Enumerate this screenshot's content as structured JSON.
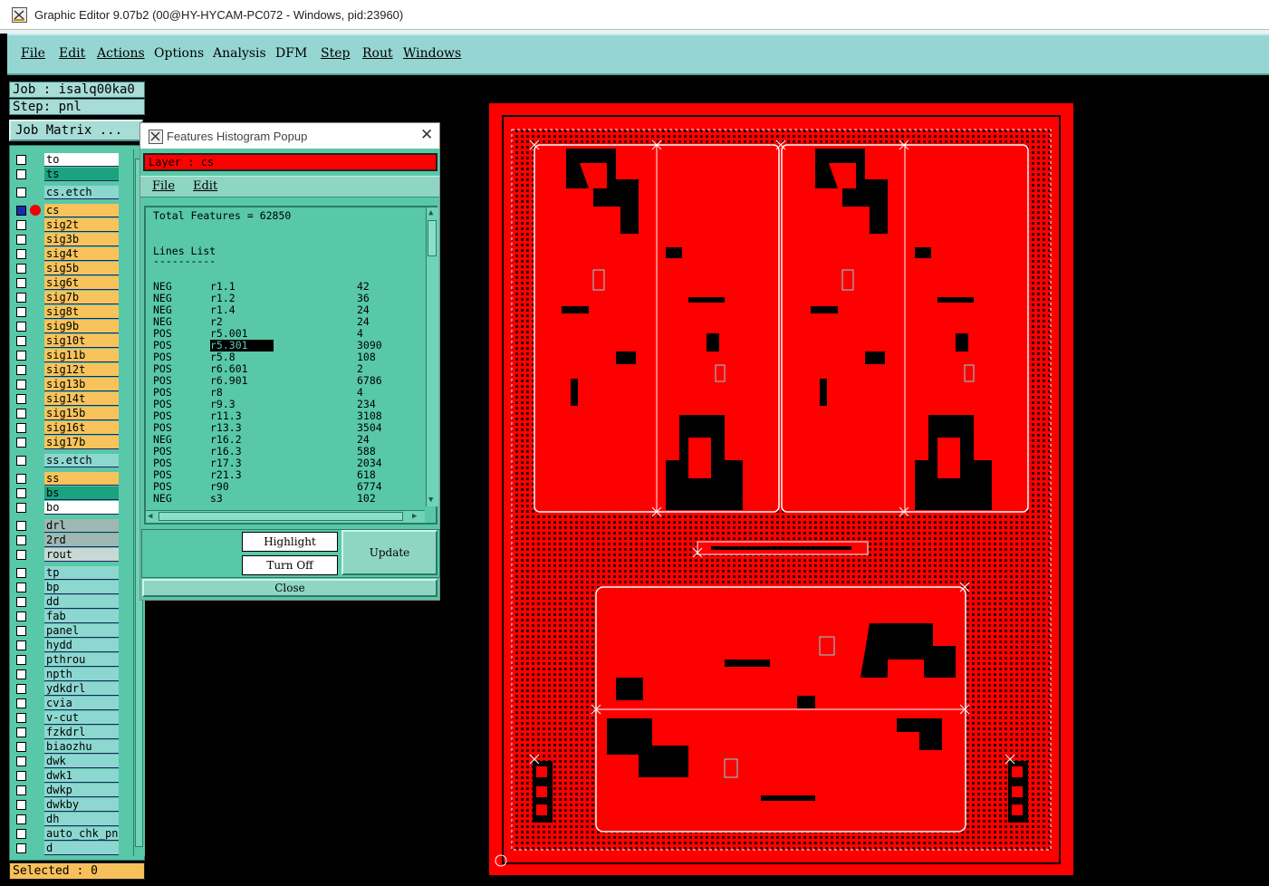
{
  "window": {
    "title": "Graphic Editor 9.07b2 (00@HY-HYCAM-PC072 - Windows, pid:23960)"
  },
  "menu": [
    {
      "label": "File",
      "u": true
    },
    {
      "label": "Edit",
      "u": true
    },
    {
      "label": "Actions",
      "u": true
    },
    {
      "label": "Options",
      "u": false
    },
    {
      "label": "Analysis",
      "u": false
    },
    {
      "label": "DFM",
      "u": false
    },
    {
      "label": "Step",
      "u": true
    },
    {
      "label": "Rout",
      "u": true
    },
    {
      "label": "Windows",
      "u": true
    }
  ],
  "job": {
    "job_text": "Job : isalq00ka0",
    "step_text": "Step: pnl",
    "matrix_button": "Job Matrix ..."
  },
  "layers": [
    {
      "name": "to",
      "color": "#ffffff"
    },
    {
      "name": "ts",
      "color": "#1aa37f"
    },
    {
      "name": "cs.etch",
      "color": "#8cd8d0"
    },
    {
      "name": "cs",
      "color": "#f7c35a",
      "active": true
    },
    {
      "name": "sig2t",
      "color": "#f7c35a"
    },
    {
      "name": "sig3b",
      "color": "#f7c35a"
    },
    {
      "name": "sig4t",
      "color": "#f7c35a"
    },
    {
      "name": "sig5b",
      "color": "#f7c35a"
    },
    {
      "name": "sig6t",
      "color": "#f7c35a"
    },
    {
      "name": "sig7b",
      "color": "#f7c35a"
    },
    {
      "name": "sig8t",
      "color": "#f7c35a"
    },
    {
      "name": "sig9b",
      "color": "#f7c35a"
    },
    {
      "name": "sig10t",
      "color": "#f7c35a"
    },
    {
      "name": "sig11b",
      "color": "#f7c35a"
    },
    {
      "name": "sig12t",
      "color": "#f7c35a"
    },
    {
      "name": "sig13b",
      "color": "#f7c35a"
    },
    {
      "name": "sig14t",
      "color": "#f7c35a"
    },
    {
      "name": "sig15b",
      "color": "#f7c35a"
    },
    {
      "name": "sig16t",
      "color": "#f7c35a"
    },
    {
      "name": "sig17b",
      "color": "#f7c35a"
    },
    {
      "name": "ss.etch",
      "color": "#8cd8d0"
    },
    {
      "name": "ss",
      "color": "#f7c35a"
    },
    {
      "name": "bs",
      "color": "#1aa37f"
    },
    {
      "name": "bo",
      "color": "#ffffff"
    },
    {
      "name": "drl",
      "color": "#9fb8b4"
    },
    {
      "name": "2rd",
      "color": "#9fb8b4"
    },
    {
      "name": "rout",
      "color": "#c8d8d4"
    },
    {
      "name": "tp",
      "color": "#8cd8d0"
    },
    {
      "name": "bp",
      "color": "#8cd8d0"
    },
    {
      "name": "dd",
      "color": "#8cd8d0"
    },
    {
      "name": "fab",
      "color": "#8cd8d0"
    },
    {
      "name": "panel",
      "color": "#8cd8d0"
    },
    {
      "name": "hydd",
      "color": "#8cd8d0"
    },
    {
      "name": "pthrou",
      "color": "#8cd8d0"
    },
    {
      "name": "npth",
      "color": "#8cd8d0"
    },
    {
      "name": "ydkdrl",
      "color": "#8cd8d0"
    },
    {
      "name": "cvia",
      "color": "#8cd8d0"
    },
    {
      "name": "v-cut",
      "color": "#8cd8d0"
    },
    {
      "name": "fzkdrl",
      "color": "#8cd8d0"
    },
    {
      "name": "biaozhu",
      "color": "#8cd8d0"
    },
    {
      "name": "dwk",
      "color": "#8cd8d0"
    },
    {
      "name": "dwk1",
      "color": "#8cd8d0"
    },
    {
      "name": "dwkp",
      "color": "#8cd8d0"
    },
    {
      "name": "dwkby",
      "color": "#8cd8d0"
    },
    {
      "name": "dh",
      "color": "#8cd8d0"
    },
    {
      "name": "auto_chk_pnl",
      "color": "#8cd8d0"
    },
    {
      "name": "d",
      "color": "#8cd8d0"
    }
  ],
  "status": {
    "selected": "Selected : 0"
  },
  "popup": {
    "title": "Features Histogram Popup",
    "layer_text": "Layer :  cs",
    "menu": [
      "File",
      "Edit"
    ],
    "total_text": "Total Features = 62850",
    "list_title": "Lines List",
    "list_rule": "----------",
    "rows": [
      {
        "pol": "NEG",
        "sym": "r1.1",
        "count": "42"
      },
      {
        "pol": "NEG",
        "sym": "r1.2",
        "count": "36"
      },
      {
        "pol": "NEG",
        "sym": "r1.4",
        "count": "24"
      },
      {
        "pol": "NEG",
        "sym": "r2",
        "count": "24"
      },
      {
        "pol": "POS",
        "sym": "r5.001",
        "count": "4"
      },
      {
        "pol": "POS",
        "sym": "r5.301",
        "count": "3090",
        "selected": true
      },
      {
        "pol": "POS",
        "sym": "r5.8",
        "count": "108"
      },
      {
        "pol": "POS",
        "sym": "r6.601",
        "count": "2"
      },
      {
        "pol": "POS",
        "sym": "r6.901",
        "count": "6786"
      },
      {
        "pol": "POS",
        "sym": "r8",
        "count": "4"
      },
      {
        "pol": "POS",
        "sym": "r9.3",
        "count": "234"
      },
      {
        "pol": "POS",
        "sym": "r11.3",
        "count": "3108"
      },
      {
        "pol": "POS",
        "sym": "r13.3",
        "count": "3504"
      },
      {
        "pol": "NEG",
        "sym": "r16.2",
        "count": "24"
      },
      {
        "pol": "POS",
        "sym": "r16.3",
        "count": "588"
      },
      {
        "pol": "POS",
        "sym": "r17.3",
        "count": "2034"
      },
      {
        "pol": "POS",
        "sym": "r21.3",
        "count": "618"
      },
      {
        "pol": "POS",
        "sym": "r90",
        "count": "6774"
      },
      {
        "pol": "NEG",
        "sym": "s3",
        "count": "102"
      }
    ],
    "buttons": {
      "highlight": "Highlight",
      "turn_off": "Turn Off",
      "update": "Update",
      "close": "Close"
    }
  },
  "colors": {
    "board": "#ff0000",
    "panel_bg": "#58c8a8",
    "menubar": "#96d6d2",
    "copper_trace": "#000000",
    "highlight": "#80d8e0"
  }
}
